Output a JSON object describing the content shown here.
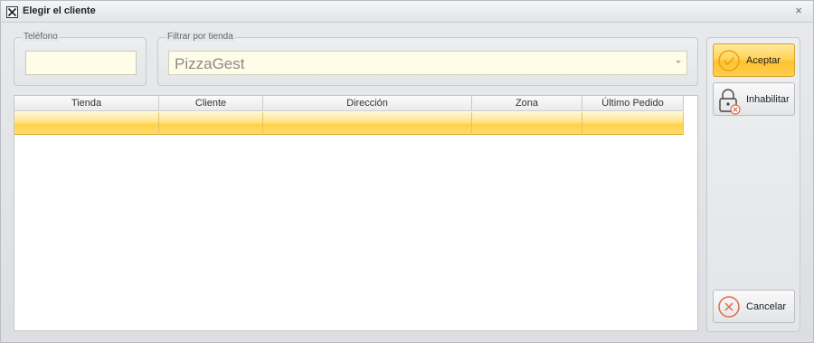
{
  "window": {
    "title": "Elegir el cliente",
    "close_glyph": "×"
  },
  "phone": {
    "label": "Teléfono",
    "value": ""
  },
  "store_filter": {
    "label": "Filtrar por tienda",
    "value": "PizzaGest"
  },
  "grid": {
    "columns": [
      "Tienda",
      "Cliente",
      "Dirección",
      "Zona",
      "Último Pedido"
    ],
    "rows": [
      [
        "",
        "",
        "",
        "",
        ""
      ]
    ]
  },
  "actions": {
    "accept_label": "Aceptar",
    "disable_label": "Inhabilitar",
    "cancel_label": "Cancelar"
  },
  "colors": {
    "accent": "#ffc230",
    "input_bg": "#fffde8",
    "check": "#e8a412",
    "cancel": "#e06a4a"
  }
}
